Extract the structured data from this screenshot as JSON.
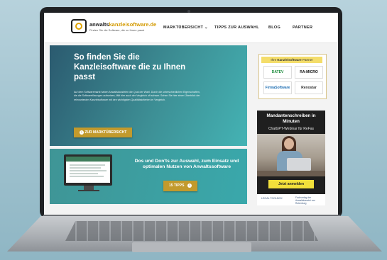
{
  "site": {
    "logo_name_part1": "anwalts",
    "logo_name_part2": "kanzleisoftware.de",
    "logo_tagline": "Finden Sie die Software, die zu Ihnen passt",
    "nav": [
      {
        "label": "MARKTÜBERSICHT",
        "has_dropdown": true
      },
      {
        "label": "TIPPS ZUR AUSWAHL"
      },
      {
        "label": "BLOG"
      },
      {
        "label": "PARTNER"
      }
    ]
  },
  "hero": {
    "title": "So finden Sie die Kanzleisoftware die zu Ihnen passt",
    "body": "Auf dem Softwaremarkt haben Anwaltskanzleien die Qual der Wahl. Durch die unterschiedlichen Eigenschaften, die die Softwarelösungen aufweisen, fällt hier auch der Vergleich oft schwer. Sehen Sie hier einen Überblick der relevantesten Kanzleisoftware mit den wichtigsten Qualitätskriterien im Vergleich.",
    "button_label": "ZUR MARKTÜBERSICHT"
  },
  "tips": {
    "title": "Dos und Don'ts zur Auswahl, zum Einsatz und optimalen Nutzen von Anwaltssoftware",
    "button_label": "15 TIPPS"
  },
  "partner_box": {
    "heading_prefix": "Ihre ",
    "heading_bold": "Kanzleisoftware",
    "heading_suffix": " Partner",
    "logos": [
      "DATEV",
      "RA-MICRO",
      "FirmaSoftware",
      "Renostar"
    ]
  },
  "webinar": {
    "title": "Mandantenschreiben in Minuten",
    "subtitle": "ChatGPT-Webinar für ReFas",
    "button_label": "Jetzt anmelden",
    "footer_left": "LEGAL TOOLBOX",
    "footer_right": "Fachverlag der Anwaltskanzlei von Rotenburg"
  },
  "colors": {
    "accent_gold": "#c29a2c",
    "hero_teal": "#3d8f95",
    "webinar_yellow": "#f2e03b"
  }
}
